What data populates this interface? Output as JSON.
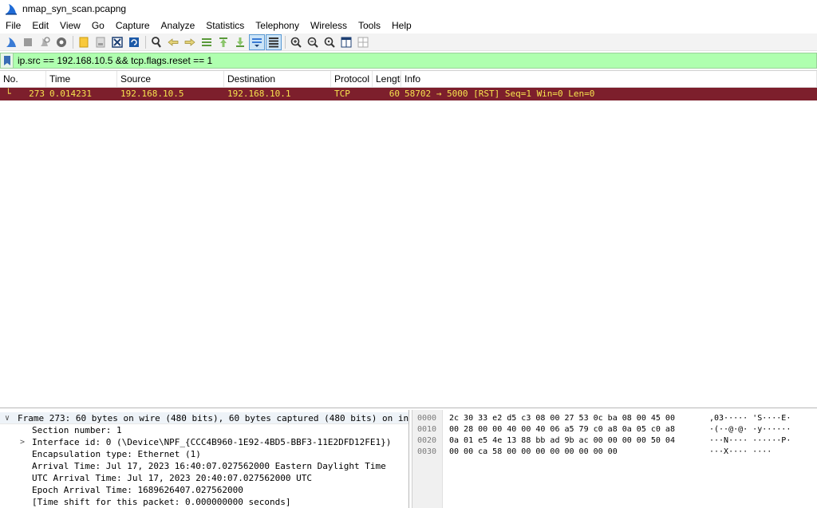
{
  "window": {
    "title": "nmap_syn_scan.pcapng"
  },
  "menu": [
    "File",
    "Edit",
    "View",
    "Go",
    "Capture",
    "Analyze",
    "Statistics",
    "Telephony",
    "Wireless",
    "Tools",
    "Help"
  ],
  "filter": {
    "value": "ip.src == 192.168.10.5 && tcp.flags.reset == 1"
  },
  "packet_list": {
    "headers": [
      "No.",
      "Time",
      "Source",
      "Destination",
      "Protocol",
      "Lengtl",
      "Info"
    ],
    "rows": [
      {
        "no": "273",
        "time": "0.014231",
        "source": "192.168.10.5",
        "destination": "192.168.10.1",
        "protocol": "TCP",
        "length": "60",
        "info": "58702 → 5000 [RST] Seq=1 Win=0 Len=0"
      }
    ],
    "row_colors": {
      "background": "#7d1f2c",
      "foreground": "#f7e44e"
    }
  },
  "details": {
    "frame_summary": "Frame 273: 60 bytes on wire (480 bits), 60 bytes captured (480 bits) on in",
    "lines": [
      "Section number: 1",
      "Interface id: 0 (\\Device\\NPF_{CCC4B960-1E92-4BD5-BBF3-11E2DFD12FE1})",
      "Encapsulation type: Ethernet (1)",
      "Arrival Time: Jul 17, 2023 16:40:07.027562000 Eastern Daylight Time",
      "UTC Arrival Time: Jul 17, 2023 20:40:07.027562000 UTC",
      "Epoch Arrival Time: 1689626407.027562000",
      "[Time shift for this packet: 0.000000000 seconds]"
    ]
  },
  "hex": {
    "rows": [
      {
        "offset": "0000",
        "bytes": "2c 30 33 e2 d5 c3 08 00  27 53 0c ba 08 00 45 00",
        "ascii": ",03·····  'S····E·"
      },
      {
        "offset": "0010",
        "bytes": "00 28 00 00 40 00 40 06  a5 79 c0 a8 0a 05 c0 a8",
        "ascii": "·(··@·@·  ·y······"
      },
      {
        "offset": "0020",
        "bytes": "0a 01 e5 4e 13 88 bb ad  9b ac 00 00 00 00 50 04",
        "ascii": "···N····  ······P·"
      },
      {
        "offset": "0030",
        "bytes": "00 00 ca 58 00 00 00 00  00 00 00 00",
        "ascii": "···X····  ····"
      }
    ]
  },
  "colors": {
    "filter_valid_bg": "#afffaf",
    "selected_row_bg": "#7d1f2c",
    "selected_row_fg": "#f7e44e",
    "toolbar_accent": "#3a7bd5"
  },
  "icons": [
    "wireshark-fin-icon",
    "stop-icon",
    "restart-icon",
    "options-gear-icon",
    "open-file-icon",
    "save-file-icon",
    "close-file-icon",
    "reload-icon",
    "find-icon",
    "back-arrow-icon",
    "forward-arrow-icon",
    "goto-packet-icon",
    "first-packet-icon",
    "last-packet-icon",
    "autoscroll-icon",
    "colorize-icon",
    "zoom-in-icon",
    "zoom-out-icon",
    "zoom-normal-icon",
    "resize-columns-icon",
    "layout-icon",
    "bookmark-icon"
  ]
}
